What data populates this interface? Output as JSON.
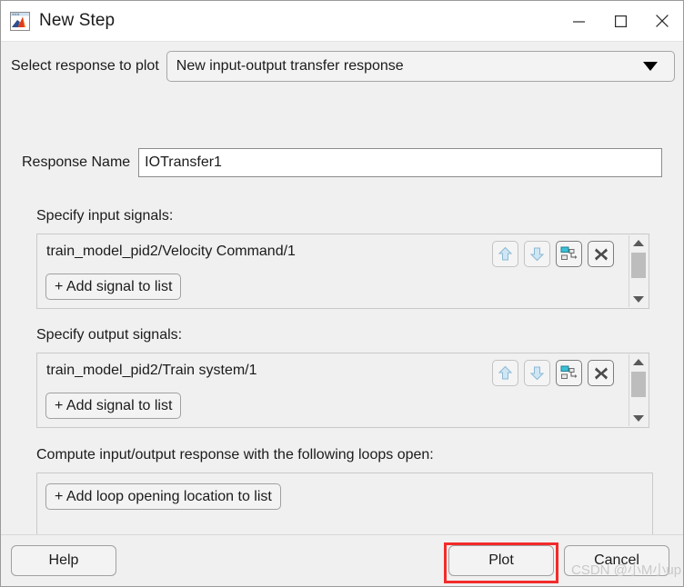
{
  "window": {
    "title": "New Step",
    "app_icon": "matlab-logo-icon",
    "controls": {
      "minimize": "minimize-icon",
      "maximize": "maximize-icon",
      "close": "close-icon"
    }
  },
  "colors": {
    "background": "#f0f0f0",
    "titlebar": "#ffffff",
    "text": "#1b1b1b",
    "panel_border": "#c9c9c9",
    "button_face": "#f3f3f3",
    "highlight_red": "#f32b2b",
    "icon_accent": "#39c2d7",
    "arrow_disabled": "#bcd9ea"
  },
  "response_select": {
    "label": "Select response to plot",
    "value": "New input-output transfer response",
    "arrow_icon": "chevron-down-icon"
  },
  "response_name": {
    "label": "Response Name",
    "value": "IOTransfer1",
    "placeholder": ""
  },
  "input_signals": {
    "label": "Specify input signals:",
    "items": [
      "train_model_pid2/Velocity Command/1"
    ],
    "add_label": "+ Add signal to list",
    "tools": [
      {
        "name": "move-up-icon",
        "enabled": false
      },
      {
        "name": "move-down-icon",
        "enabled": false
      },
      {
        "name": "select-block-icon",
        "enabled": true
      },
      {
        "name": "delete-icon",
        "enabled": true
      }
    ],
    "scrollbar": true
  },
  "output_signals": {
    "label": "Specify output signals:",
    "items": [
      "train_model_pid2/Train system/1"
    ],
    "add_label": "+ Add signal to list",
    "tools": [
      {
        "name": "move-up-icon",
        "enabled": false
      },
      {
        "name": "move-down-icon",
        "enabled": false
      },
      {
        "name": "select-block-icon",
        "enabled": true
      },
      {
        "name": "delete-icon",
        "enabled": true
      }
    ],
    "scrollbar": true
  },
  "loop_openings": {
    "label": "Compute input/output response with the following loops open:",
    "add_label": "+ Add loop opening location to list"
  },
  "footer": {
    "help_label": "Help",
    "plot_label": "Plot",
    "cancel_label": "Cancel"
  },
  "watermark": {
    "text": "CSDN @小M小up"
  }
}
